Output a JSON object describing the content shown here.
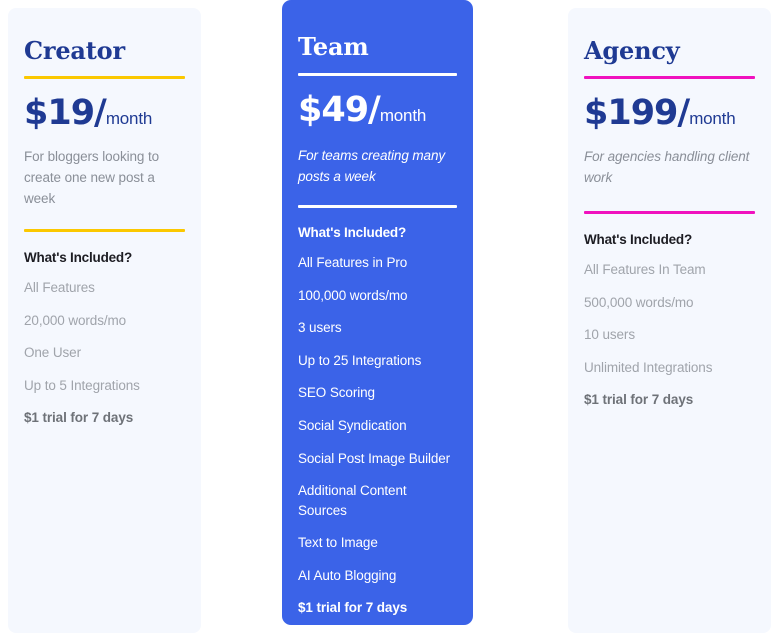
{
  "colors": {
    "page_background": "#ffffff",
    "card_background": "#f5f8fe",
    "featured_background": "#3b63e8",
    "heading_navy": "#1f3a93",
    "accent_creator": "#fbc800",
    "accent_agency": "#f012be",
    "accent_team": "#ffffff",
    "body_gray": "#a0a4ab",
    "included_title": "#1d1d23"
  },
  "plans": [
    {
      "id": "creator",
      "name": "Creator",
      "price_amount": "$19/",
      "price_period": "month",
      "description": "For bloggers looking to create one new post a week",
      "description_italic": false,
      "featured": false,
      "included_title": "What's Included?",
      "features": [
        {
          "label": "All Features",
          "strong": false
        },
        {
          "label": "20,000 words/mo",
          "strong": false
        },
        {
          "label": "One User",
          "strong": false
        },
        {
          "label": "Up to 5 Integrations",
          "strong": false
        },
        {
          "label": "$1 trial for 7 days",
          "strong": true
        }
      ]
    },
    {
      "id": "team",
      "name": "Team",
      "price_amount": "$49/",
      "price_period": "month",
      "description": "For teams creating many posts a week",
      "description_italic": true,
      "featured": true,
      "included_title": "What's Included?",
      "features": [
        {
          "label": "All Features in Pro",
          "strong": false
        },
        {
          "label": "100,000 words/mo",
          "strong": false
        },
        {
          "label": "3 users",
          "strong": false
        },
        {
          "label": "Up to 25 Integrations",
          "strong": false
        },
        {
          "label": "SEO Scoring",
          "strong": false
        },
        {
          "label": "Social Syndication",
          "strong": false
        },
        {
          "label": "Social Post Image Builder",
          "strong": false
        },
        {
          "label": "Additional Content Sources",
          "strong": false
        },
        {
          "label": "Text to Image",
          "strong": false
        },
        {
          "label": "AI Auto Blogging",
          "strong": false
        },
        {
          "label": "$1 trial for 7 days",
          "strong": true
        }
      ]
    },
    {
      "id": "agency",
      "name": "Agency",
      "price_amount": "$199/",
      "price_period": "month",
      "description": "For agencies handling client work",
      "description_italic": true,
      "featured": false,
      "included_title": "What's Included?",
      "features": [
        {
          "label": "All Features In Team",
          "strong": false
        },
        {
          "label": "500,000 words/mo",
          "strong": false
        },
        {
          "label": "10 users",
          "strong": false
        },
        {
          "label": "Unlimited Integrations",
          "strong": false
        },
        {
          "label": "$1 trial for 7 days",
          "strong": true
        }
      ]
    }
  ]
}
